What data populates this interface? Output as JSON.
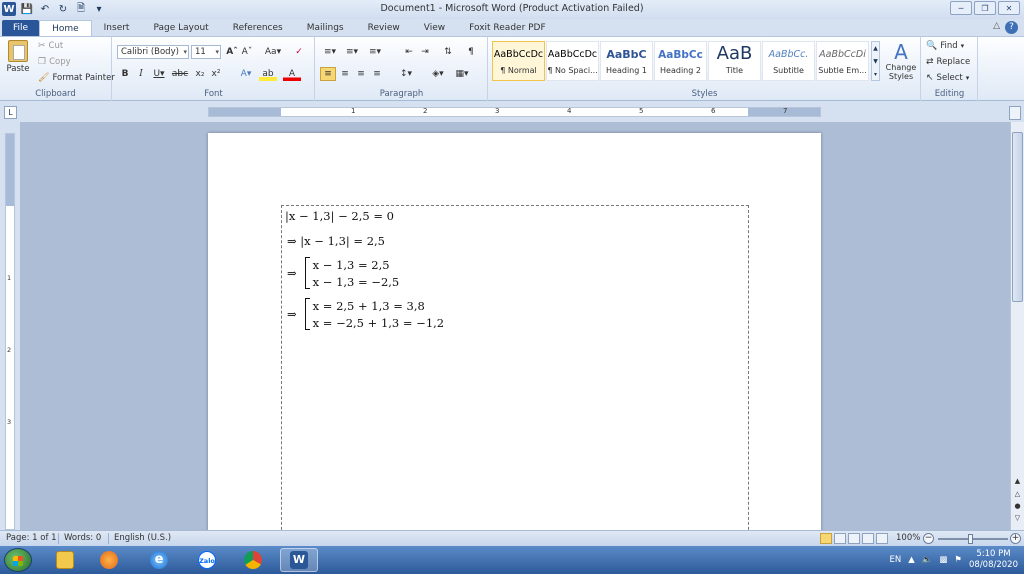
{
  "window": {
    "title": "Document1 - Microsoft Word (Product Activation Failed)",
    "controls": [
      "minimize",
      "restore",
      "close"
    ]
  },
  "tabs": [
    {
      "label": "File"
    },
    {
      "label": "Home"
    },
    {
      "label": "Insert"
    },
    {
      "label": "Page Layout"
    },
    {
      "label": "References"
    },
    {
      "label": "Mailings"
    },
    {
      "label": "Review"
    },
    {
      "label": "View"
    },
    {
      "label": "Foxit Reader PDF"
    }
  ],
  "ribbon": {
    "clipboard": {
      "label": "Clipboard",
      "paste": "Paste",
      "cut": "Cut",
      "copy": "Copy",
      "format_painter": "Format Painter"
    },
    "font": {
      "label": "Font",
      "name": "Calibri (Body)",
      "size": "11"
    },
    "paragraph": {
      "label": "Paragraph"
    },
    "styles": {
      "label": "Styles",
      "items": [
        {
          "preview": "AaBbCcDc",
          "name": "¶ Normal"
        },
        {
          "preview": "AaBbCcDc",
          "name": "¶ No Spaci..."
        },
        {
          "preview": "AaBbC",
          "name": "Heading 1"
        },
        {
          "preview": "AaBbCc",
          "name": "Heading 2"
        },
        {
          "preview": "AaB",
          "name": "Title"
        },
        {
          "preview": "AaBbCc.",
          "name": "Subtitle"
        },
        {
          "preview": "AaBbCcDi",
          "name": "Subtle Em..."
        }
      ],
      "change_styles": "Change Styles"
    },
    "editing": {
      "label": "Editing",
      "find": "Find",
      "replace": "Replace",
      "select": "Select"
    }
  },
  "ruler": {
    "numbers": [
      "1",
      "2",
      "3",
      "4",
      "5",
      "6",
      "7"
    ],
    "vertical_numbers": [
      "1",
      "2",
      "3"
    ]
  },
  "document": {
    "lines": {
      "l1": "|x − 1,3| − 2,5 = 0",
      "l2": "⇒ |x − 1,3| = 2,5",
      "l3a": "x − 1,3 = 2,5",
      "l3b": "x − 1,3 = −2,5",
      "l4a": "x = 2,5 + 1,3 = 3,8",
      "l4b": "x = −2,5 + 1,3 = −1,2",
      "arrow": "⇒"
    }
  },
  "status": {
    "page": "Page: 1 of 1",
    "words": "Words: 0",
    "language": "English (U.S.)",
    "zoom": "100%"
  },
  "taskbar": {
    "apps": [
      "file-explorer",
      "media-player",
      "internet-explorer",
      "zalo",
      "chrome",
      "word"
    ],
    "zalo_label": "Zalo",
    "lang": "EN",
    "time": "5:10 PM",
    "date": "08/08/2020"
  },
  "colors": {
    "file_tab": "#2a5699",
    "accent": "#2b5797",
    "doc_bg": "#adbdd5"
  }
}
